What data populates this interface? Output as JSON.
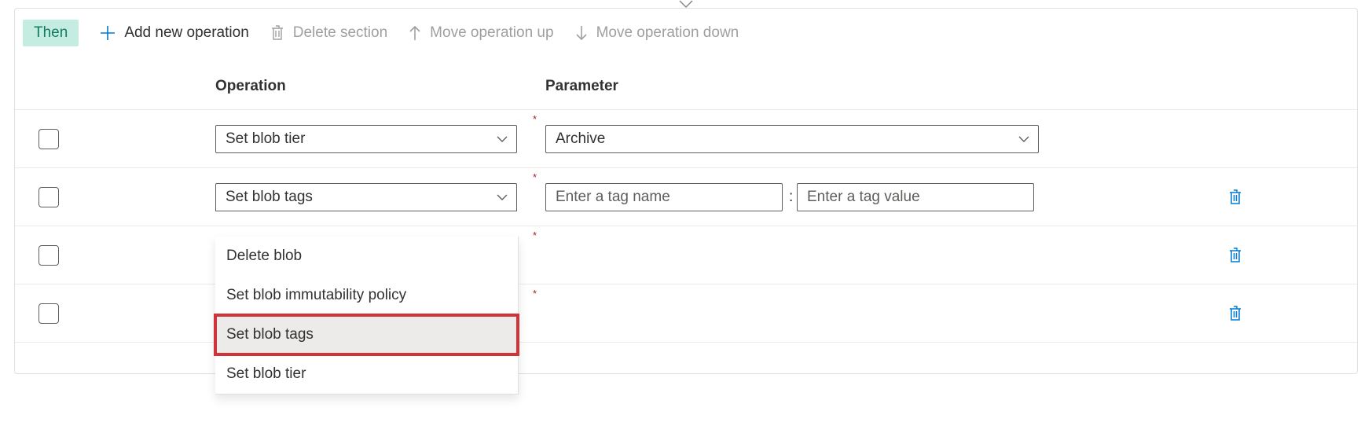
{
  "section_label": "Then",
  "toolbar": {
    "add": "Add new operation",
    "delete_section": "Delete section",
    "move_up": "Move operation up",
    "move_down": "Move operation down"
  },
  "headers": {
    "operation": "Operation",
    "parameter": "Parameter"
  },
  "rows": [
    {
      "operation": "Set blob tier",
      "parameter_type": "select",
      "parameter_value": "Archive",
      "deletable": false
    },
    {
      "operation": "Set blob tags",
      "parameter_type": "tag",
      "tag_name_placeholder": "Enter a tag name",
      "tag_value_placeholder": "Enter a tag value",
      "deletable": true
    },
    {
      "operation": "",
      "parameter_type": "none",
      "deletable": true
    },
    {
      "operation": "",
      "parameter_type": "none",
      "deletable": true
    }
  ],
  "dropdown": {
    "items": [
      "Delete blob",
      "Set blob immutability policy",
      "Set blob tags",
      "Set blob tier"
    ],
    "highlighted": "Set blob tags"
  },
  "glyphs": {
    "colon": ":"
  }
}
